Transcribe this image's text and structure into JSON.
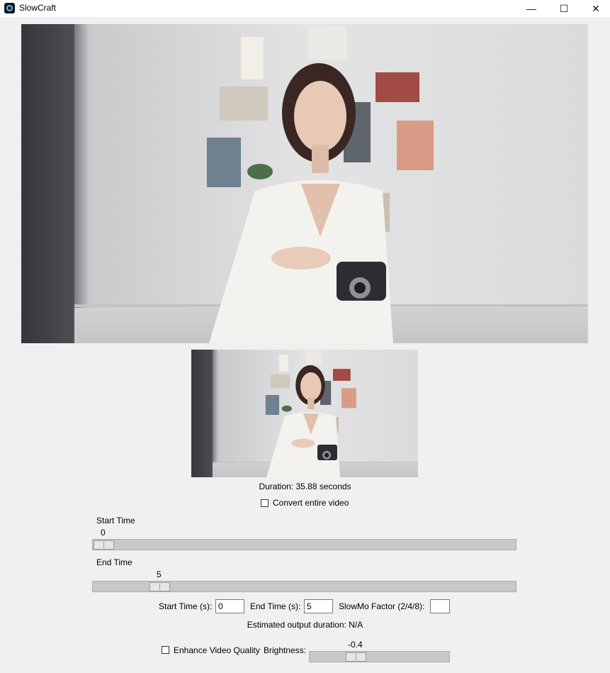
{
  "window": {
    "title": "SlowCraft",
    "minimize_glyph": "—",
    "maximize_glyph": "☐",
    "close_glyph": "✕"
  },
  "preview": {
    "main_image": "video-frame-woman-with-camera",
    "thumbnail_image": "video-thumbnail-woman-with-camera"
  },
  "duration_text": "Duration: 35.88 seconds",
  "convert_entire": {
    "label": "Convert entire video",
    "checked": false
  },
  "start_scale": {
    "label": "Start Time",
    "value": "0",
    "fraction": 0.0
  },
  "end_scale": {
    "label": "End Time",
    "value": "5",
    "fraction": 0.139
  },
  "fields": {
    "start_label": "Start Time (s):",
    "start_value": "0",
    "end_label": "End Time (s):",
    "end_value": "5",
    "slowmo_label": "SlowMo Factor (2/4/8):",
    "slowmo_value": ""
  },
  "estimated_text": "Estimated output duration: N/A",
  "enhance": {
    "label": "Enhance Video Quality",
    "checked": false
  },
  "brightness": {
    "label": "Brightness:",
    "value": "-0.4",
    "fraction": 0.3
  },
  "colors": {
    "trough": "#c8c8c8",
    "window_bg": "#f0f0f0"
  }
}
